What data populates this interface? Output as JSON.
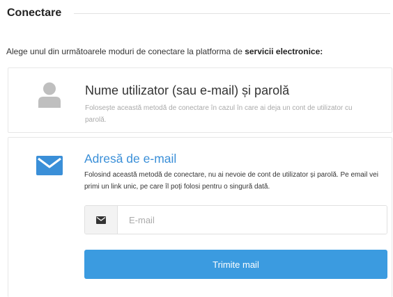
{
  "header": {
    "title": "Conectare"
  },
  "intro": {
    "text": "Alege unul din următoarele moduri de conectare la platforma de ",
    "bold": "servicii electronice:"
  },
  "options": [
    {
      "icon": "user-icon",
      "title": "Nume utilizator (sau e-mail) și parolă",
      "description": "Folosește această metodă de conectare în cazul în care ai deja un cont de utilizator cu parolă."
    },
    {
      "icon": "envelope-icon",
      "title": "Adresă de e-mail",
      "description": "Folosind această metodă de conectare, nu ai nevoie de cont de utilizator și parolă. Pe email vei primi un link unic, pe care îl poți folosi pentru o singură dată.",
      "email_input": {
        "value": "",
        "placeholder": "E-mail",
        "addon_icon": "envelope-icon"
      },
      "submit_label": "Trimite mail"
    }
  ],
  "colors": {
    "accent": "#3a8fd8",
    "button": "#3b9be0",
    "icon_gray": "#bfbfbf"
  }
}
